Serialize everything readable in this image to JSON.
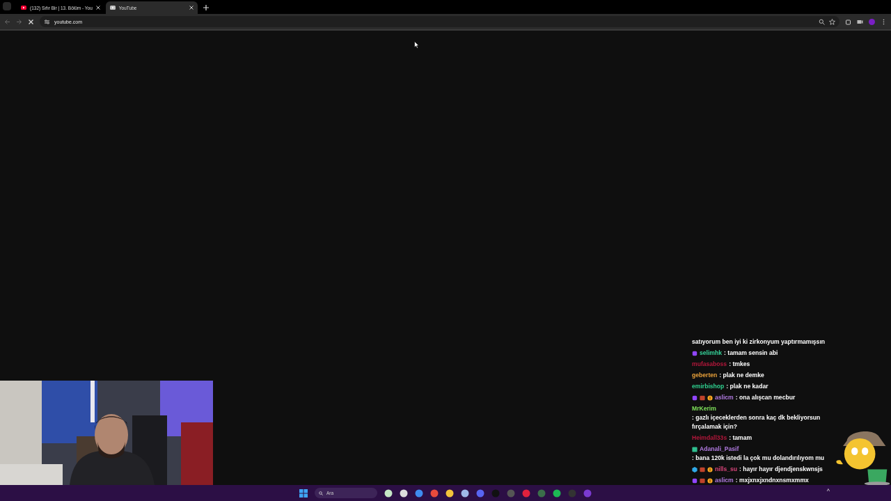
{
  "browser": {
    "tabs": [
      {
        "title": "(132) Sıfır Bir | 13. Bölüm - You",
        "selected": false
      },
      {
        "title": "YouTube",
        "selected": true
      }
    ],
    "address": "youtube.com",
    "loading": true
  },
  "chat": [
    {
      "text": "satıyorum ben iyi ki zirkonyum yaptırmamışsın"
    },
    {
      "user": "selimhk",
      "color": "#36d39a",
      "badges": [
        {
          "kind": "sub"
        }
      ],
      "text": ": tamam sensin abi"
    },
    {
      "user": "mufasaboss",
      "color": "#b3173b",
      "text": ": tmkes"
    },
    {
      "user": "geberten",
      "color": "#e8a03a",
      "text": ": plak ne demke"
    },
    {
      "user": "emirbishop",
      "color": "#2fd08f",
      "text": ": plak ne kadar"
    },
    {
      "user": "aslicm",
      "color": "#b07ae0",
      "badges": [
        {
          "kind": "sub"
        },
        {
          "kind": "gift"
        },
        {
          "kind": "bits"
        }
      ],
      "text": ": ona alışcan mecbur"
    },
    {
      "user": "MrKerim",
      "color": "#7ee05a",
      "text": ": gazlı içeceklerden sonra kaç dk bekliyorsun fırçalamak için?"
    },
    {
      "user": "Heimdall33s",
      "color": "#b3173b",
      "text": ": tamam"
    },
    {
      "user": "Adanali_Pasif",
      "color": "#b07ae0",
      "badges": [
        {
          "kind": "vip"
        }
      ],
      "text": ": bana 120k istedi la çok mu dolandırılıyom mu"
    },
    {
      "user": "nills_su",
      "color": "#d8447a",
      "badges": [
        {
          "kind": "prime"
        },
        {
          "kind": "gift"
        },
        {
          "kind": "bits"
        }
      ],
      "text": ": hayır hayır djendjenskwnsjs"
    },
    {
      "user": "aslicm",
      "color": "#b07ae0",
      "badges": [
        {
          "kind": "sub"
        },
        {
          "kind": "gift"
        },
        {
          "kind": "bits"
        }
      ],
      "text": ": mxjxnxjxndnxnsmxmmx"
    }
  ],
  "taskbar": {
    "search": {
      "placeholder": "Ara"
    },
    "tray": "^"
  }
}
